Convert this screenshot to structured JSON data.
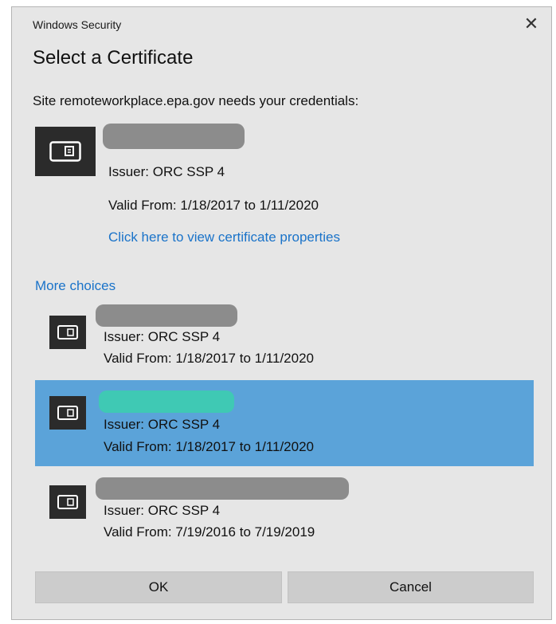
{
  "window": {
    "title": "Windows Security",
    "close_glyph": "✕"
  },
  "dialog": {
    "heading": "Select a Certificate",
    "subtitle": "Site remoteworkplace.epa.gov needs your credentials:"
  },
  "primary_certificate": {
    "icon": "certificate-icon",
    "issuer": "Issuer: ORC SSP 4",
    "valid": "Valid From: 1/18/2017 to 1/11/2020",
    "properties_link": "Click here to view certificate properties"
  },
  "more_choices_label": "More choices",
  "certificates": [
    {
      "issuer": "Issuer: ORC SSP 4",
      "valid": "Valid From: 1/18/2017 to 1/11/2020",
      "selected": false
    },
    {
      "issuer": "Issuer: ORC SSP 4",
      "valid": "Valid From: 1/18/2017 to 1/11/2020",
      "selected": true
    },
    {
      "issuer": "Issuer: ORC SSP 4",
      "valid": "Valid From: 7/19/2016 to 7/19/2019",
      "selected": false
    }
  ],
  "buttons": {
    "ok": "OK",
    "cancel": "Cancel"
  },
  "colors": {
    "dialog_bg": "#e6e6e6",
    "selected_bg": "#5ba3d9",
    "link": "#1a73c9",
    "icon_bg": "#2b2b2b",
    "redaction": "#8c8c8c",
    "redaction_selected": "#3fc9b4"
  }
}
